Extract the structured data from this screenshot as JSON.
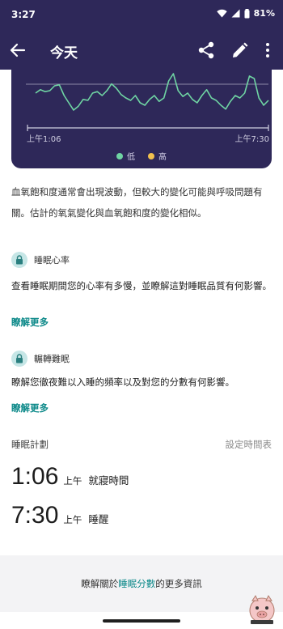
{
  "status": {
    "time": "3:27",
    "battery": "81%"
  },
  "app_bar": {
    "title": "今天"
  },
  "chart": {
    "x_start": "上午1:06",
    "x_end": "上午7:30",
    "legend_low": "低",
    "legend_high": "高",
    "line_color": "#6fd4a3",
    "low_color": "#6fd4a3",
    "high_color": "#f2c14e"
  },
  "chart_data": {
    "type": "line",
    "title": "",
    "xlabel": "",
    "ylabel": "",
    "x": [
      "上午1:06",
      "上午7:30"
    ],
    "series": [
      {
        "values": [
          0.55,
          0.62,
          0.58,
          0.6,
          0.7,
          0.72,
          0.5,
          0.35,
          0.2,
          0.28,
          0.42,
          0.4,
          0.55,
          0.58,
          0.5,
          0.6,
          0.74,
          0.65,
          0.52,
          0.45,
          0.4,
          0.5,
          0.35,
          0.3,
          0.42,
          0.5,
          0.38,
          0.45,
          0.8,
          0.95,
          0.6,
          0.48,
          0.55,
          0.42,
          0.35,
          0.5,
          0.62,
          0.45,
          0.4,
          0.3,
          0.22,
          0.38,
          0.5,
          0.45,
          0.55,
          0.9,
          0.85,
          0.45,
          0.3,
          0.4
        ]
      }
    ],
    "legend": [
      "低",
      "高"
    ]
  },
  "description": "血氧飽和度通常會出現波動，但較大的變化可能與呼吸問題有關。估計的氧氣變化與血氧飽和度的變化相似。",
  "sections": [
    {
      "title": "睡眠心率",
      "body": "查看睡眠期間您的心率有多慢，並瞭解這對睡眠品質有何影響。",
      "link": "瞭解更多"
    },
    {
      "title": "輾轉難眠",
      "body": "瞭解您徹夜難以入睡的頻率以及對您的分數有何影響。",
      "link": "瞭解更多"
    }
  ],
  "plan": {
    "title": "睡眠計劃",
    "set_link": "設定時間表",
    "bedtime": {
      "time": "1:06",
      "ampm": "上午",
      "label": "就寢時間"
    },
    "wake": {
      "time": "7:30",
      "ampm": "上午",
      "label": "睡醒"
    }
  },
  "footer": {
    "prefix": "瞭解關於",
    "link": "睡眠分數",
    "suffix": "的更多資訊"
  }
}
